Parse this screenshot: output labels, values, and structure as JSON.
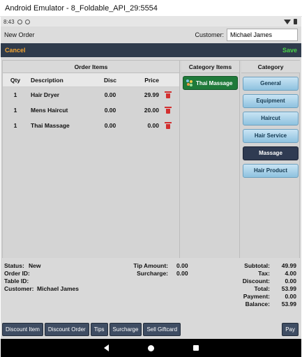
{
  "window": {
    "title": "Android Emulator - 8_Foldable_API_29:5554"
  },
  "status_bar": {
    "time": "8:43"
  },
  "header": {
    "screen_title": "New Order",
    "customer_label": "Customer:",
    "customer_value": "Michael James"
  },
  "actions": {
    "cancel_label": "Cancel",
    "save_label": "Save"
  },
  "order_items": {
    "title": "Order Items",
    "columns": {
      "qty": "Qty",
      "description": "Description",
      "disc": "Disc",
      "price": "Price"
    },
    "rows": [
      {
        "qty": "1",
        "description": "Hair Dryer",
        "disc": "0.00",
        "price": "29.99"
      },
      {
        "qty": "1",
        "description": "Mens Haircut",
        "disc": "0.00",
        "price": "20.00"
      },
      {
        "qty": "1",
        "description": "Thai Massage",
        "disc": "0.00",
        "price": "0.00"
      }
    ]
  },
  "category_items": {
    "title": "Category Items",
    "items": [
      {
        "label": "Thai Massage",
        "icon": "massage-icon"
      }
    ]
  },
  "categories": {
    "title": "Category",
    "items": [
      {
        "label": "General"
      },
      {
        "label": "Equipment"
      },
      {
        "label": "Haircut"
      },
      {
        "label": "Hair Service"
      },
      {
        "label": "Massage"
      },
      {
        "label": "Hair Product"
      }
    ],
    "selected": "Massage"
  },
  "summary": {
    "status_label": "Status:",
    "status_value": "New",
    "order_id_label": "Order ID:",
    "table_id_label": "Table ID:",
    "customer_label": "Customer:",
    "customer_value": "Michael James",
    "tip_amount_label": "Tip Amount:",
    "tip_amount_value": "0.00",
    "surcharge_label": "Surcharge:",
    "surcharge_value": "0.00",
    "subtotal_label": "Subtotal:",
    "subtotal_value": "49.99",
    "tax_label": "Tax:",
    "tax_value": "4.00",
    "discount_label": "Discount:",
    "discount_value": "0.00",
    "total_label": "Total:",
    "total_value": "53.99",
    "payment_label": "Payment:",
    "payment_value": "0.00",
    "balance_label": "Balance:",
    "balance_value": "53.99"
  },
  "bottom_buttons": {
    "discount_item": "Discount Item",
    "discount_order": "Discount Order",
    "tips": "Tips",
    "surcharge": "Surcharge",
    "sell_giftcard": "Sell Giftcard",
    "pay": "Pay"
  },
  "colors": {
    "action_bar": "#2f3b4c",
    "cancel": "#f3a431",
    "save": "#49d449",
    "category_item": "#1f7a3a",
    "selected_category": "#2f3b52",
    "delete": "#d32f2f"
  }
}
